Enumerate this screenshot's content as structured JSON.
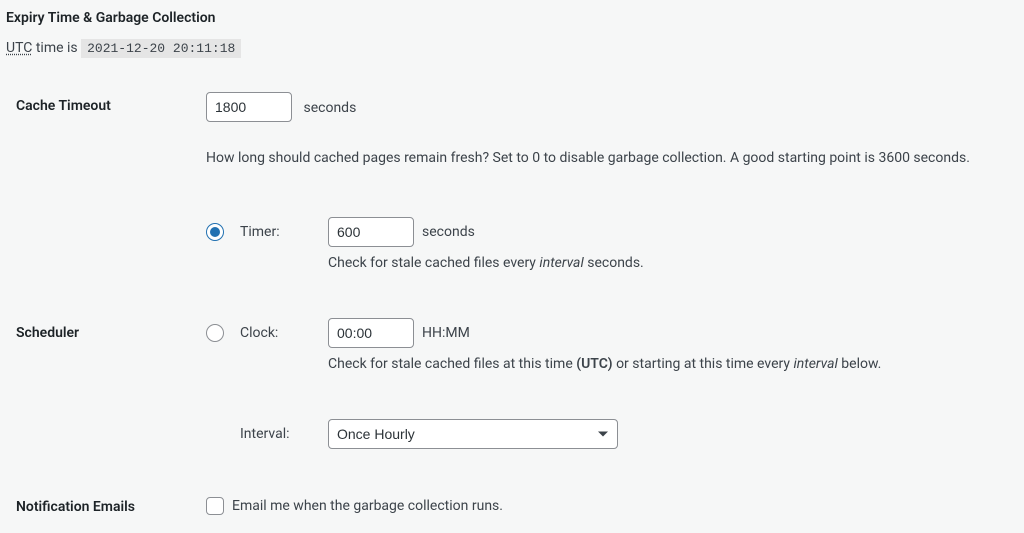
{
  "section_title": "Expiry Time & Garbage Collection",
  "utc_prefix": "UTC",
  "utc_middle": " time is ",
  "utc_time": "2021-12-20 20:11:18",
  "cache_timeout": {
    "label": "Cache Timeout",
    "value": "1800",
    "units": "seconds",
    "description": "How long should cached pages remain fresh? Set to 0 to disable garbage collection. A good starting point is 3600 seconds."
  },
  "scheduler": {
    "label": "Scheduler",
    "timer": {
      "radio_label": "Timer:",
      "value": "600",
      "units": "seconds",
      "desc_pre": "Check for stale cached files every ",
      "desc_em": "interval",
      "desc_post": " seconds."
    },
    "clock": {
      "radio_label": "Clock:",
      "value": "00:00",
      "units": "HH:MM",
      "desc_pre": "Check for stale cached files at this time ",
      "desc_strong": "(UTC)",
      "desc_mid": " or starting at this time every ",
      "desc_em": "interval",
      "desc_post": " below."
    },
    "interval": {
      "label": "Interval:",
      "value": "Once Hourly"
    }
  },
  "notification": {
    "label": "Notification Emails",
    "checkbox_label": "Email me when the garbage collection runs."
  }
}
